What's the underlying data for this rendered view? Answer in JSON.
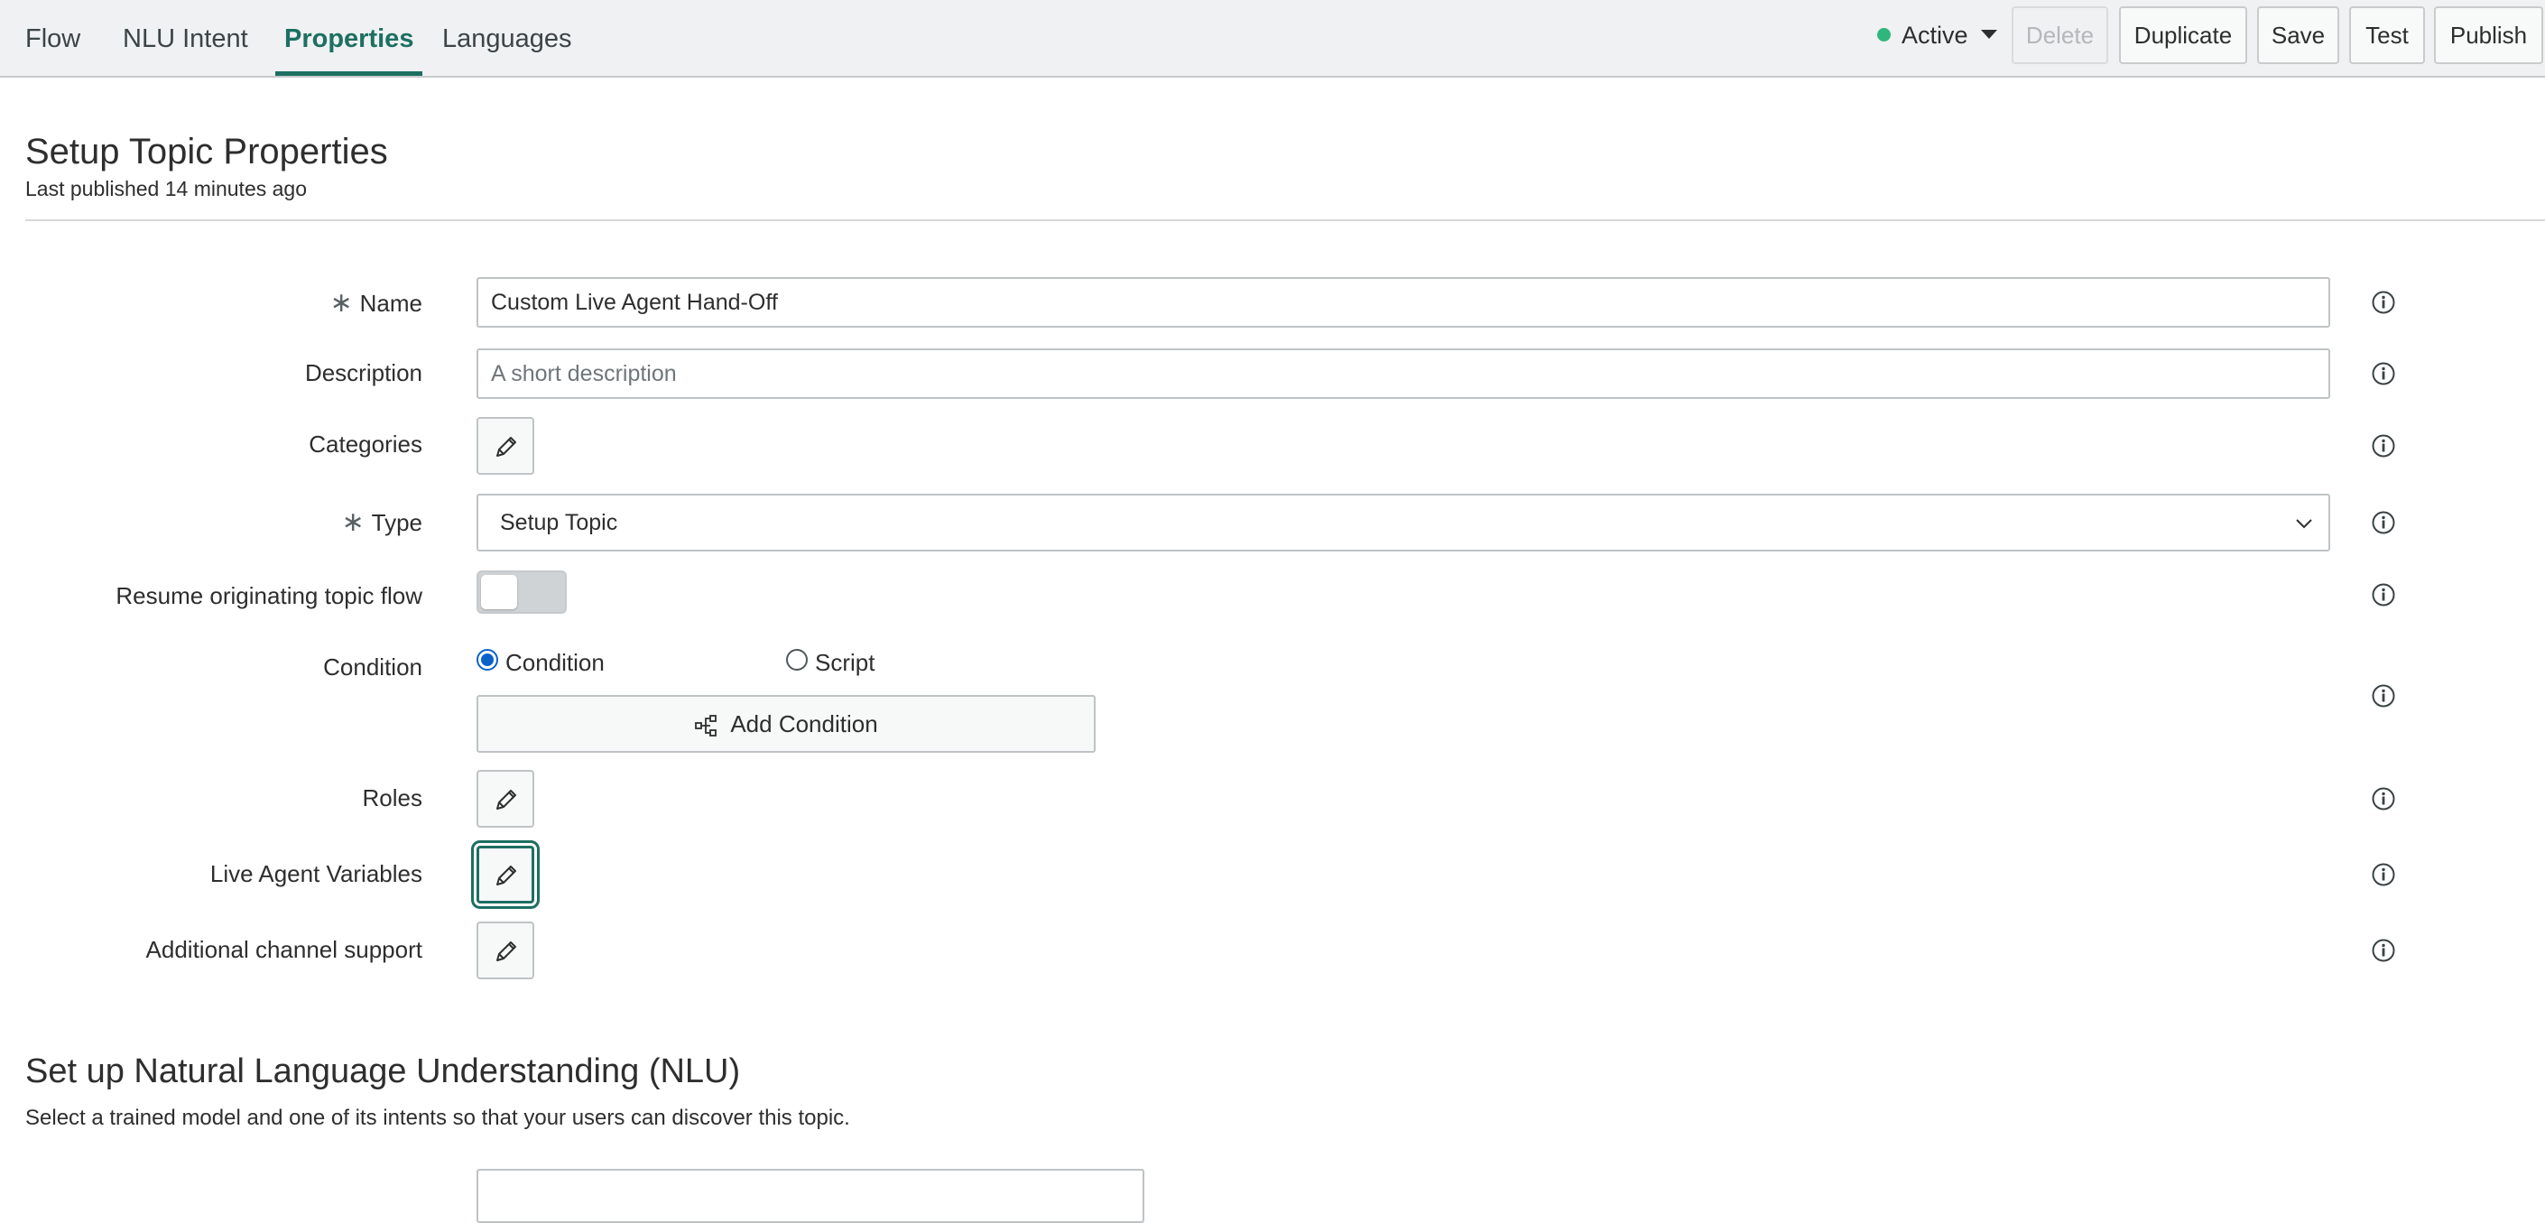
{
  "tabs": [
    {
      "label": "Flow",
      "active": false
    },
    {
      "label": "NLU Intent",
      "active": false
    },
    {
      "label": "Properties",
      "active": true
    },
    {
      "label": "Languages",
      "active": false
    }
  ],
  "toolbar": {
    "status_label": "Active",
    "status_color": "#2fb67c",
    "delete_label": "Delete",
    "duplicate_label": "Duplicate",
    "save_label": "Save",
    "test_label": "Test",
    "publish_label": "Publish"
  },
  "header": {
    "title": "Setup Topic Properties",
    "last_published": "Last published 14 minutes ago"
  },
  "form": {
    "required_mark": "∗",
    "name": {
      "label": "Name",
      "value": "Custom Live Agent Hand-Off"
    },
    "description": {
      "label": "Description",
      "value": "",
      "placeholder": "A short description"
    },
    "categories": {
      "label": "Categories"
    },
    "type": {
      "label": "Type",
      "value": "Setup Topic"
    },
    "resume": {
      "label": "Resume originating topic flow",
      "on": false
    },
    "condition": {
      "label": "Condition",
      "option_condition": "Condition",
      "option_script": "Script",
      "selected": "Condition",
      "add_label": "Add Condition"
    },
    "roles": {
      "label": "Roles"
    },
    "live_agent_variables": {
      "label": "Live Agent Variables"
    },
    "additional_channel_support": {
      "label": "Additional channel support"
    }
  },
  "nlu": {
    "title": "Set up Natural Language Understanding (NLU)",
    "description": "Select a trained model and one of its intents so that your users can discover this topic."
  },
  "colors": {
    "accent": "#1d6f62",
    "radio": "#0b63c7"
  }
}
